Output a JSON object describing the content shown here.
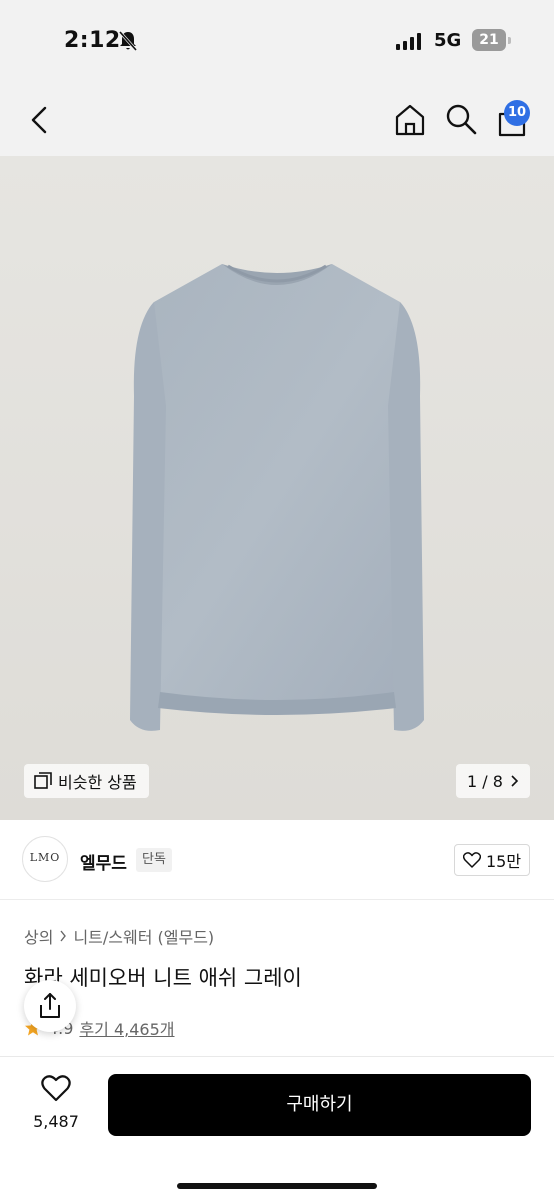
{
  "status_bar": {
    "time": "2:12",
    "network": "5G",
    "battery": "21",
    "icons": [
      "bell-off-icon",
      "signal-icon",
      "battery-icon"
    ]
  },
  "header": {
    "icons": [
      "back-icon",
      "home-icon",
      "search-icon",
      "cart-icon"
    ],
    "cart_badge": "10"
  },
  "gallery": {
    "similar_label": "비슷한 상품",
    "similar_icon": "gallery-icon",
    "page_indicator": "1 / 8",
    "logo_text": "LMO"
  },
  "brand": {
    "logo_text": "LMO",
    "name": "엘무드",
    "tag": "단독",
    "likes": "15만",
    "like_icon": "heart-icon"
  },
  "product": {
    "breadcrumb": [
      "상의",
      "니트/스웨터 (엘무드)"
    ],
    "title": "화라 세미오버 니트 애쉬 그레이",
    "rating": "4.9",
    "reviews": "후기 4,465개",
    "rating_icon": "star-icon"
  },
  "bottom": {
    "wish_count": "5,487",
    "buy_label": "구매하기"
  },
  "colors": {
    "accent_blue": "#2f6fe4",
    "star": "#f5a623",
    "buy_button": "#000000"
  }
}
